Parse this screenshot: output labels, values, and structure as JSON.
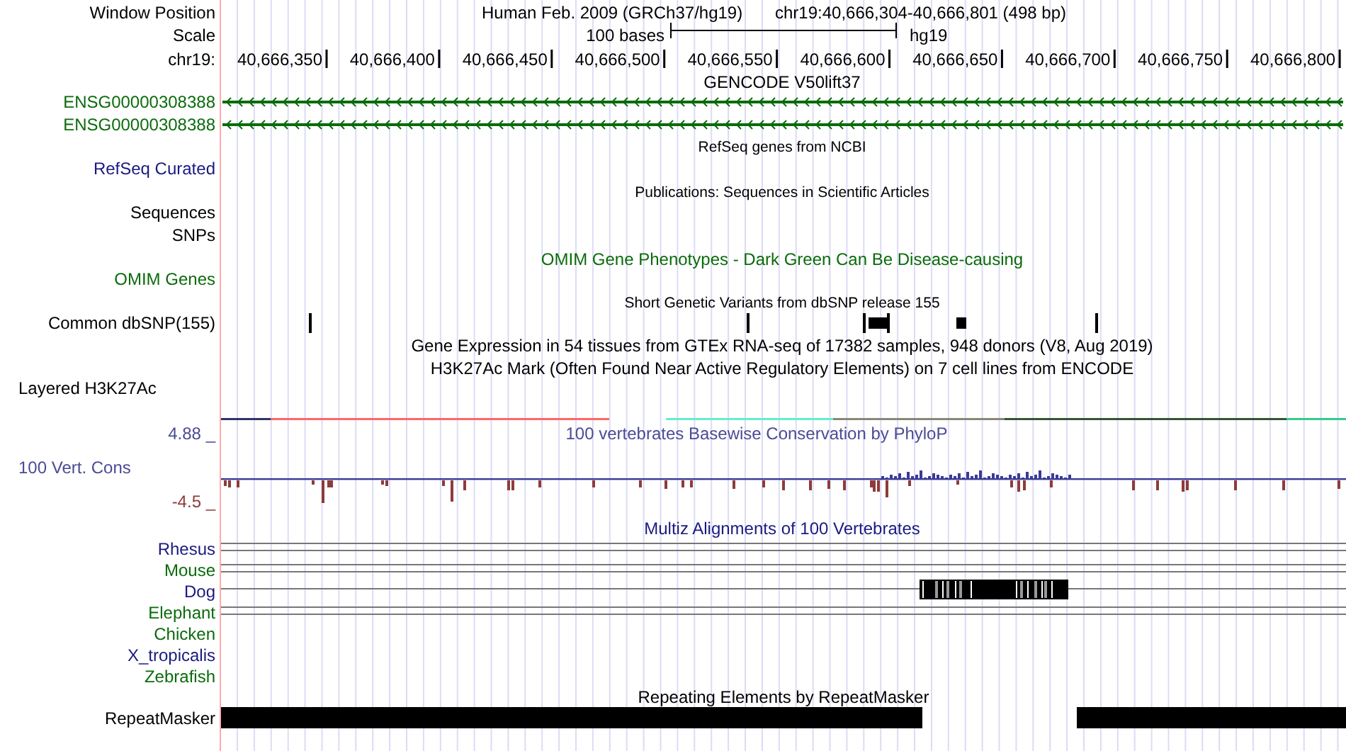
{
  "header": {
    "position_label": "Window Position",
    "assembly": "Human Feb. 2009 (GRCh37/hg19)",
    "position": "chr19:40,666,304-40,666,801 (498 bp)"
  },
  "scale": {
    "label": "Scale",
    "length": "100 bases",
    "db": "hg19"
  },
  "ruler": {
    "label": "chr19:",
    "ticks": [
      "40,666,350",
      "40,666,400",
      "40,666,450",
      "40,666,500",
      "40,666,550",
      "40,666,600",
      "40,666,650",
      "40,666,700",
      "40,666,750",
      "40,666,800"
    ]
  },
  "tracks": [
    {
      "kind": "title",
      "title": "GENCODE V50lift37",
      "color": "#000000"
    },
    {
      "kind": "gene",
      "label": "ENSG00000308388",
      "color": "#0b6b0b"
    },
    {
      "kind": "gene",
      "label": "ENSG00000308388",
      "color": "#0b6b0b"
    },
    {
      "kind": "note",
      "title": "RefSeq genes from NCBI"
    },
    {
      "kind": "label",
      "label": "RefSeq Curated",
      "color": "#1a1a80"
    },
    {
      "kind": "note",
      "title": "Publications: Sequences in Scientific Articles"
    },
    {
      "kind": "label",
      "label": "Sequences",
      "color": "#000000"
    },
    {
      "kind": "label",
      "label": "SNPs",
      "color": "#000000"
    },
    {
      "kind": "title",
      "title": "OMIM Gene Phenotypes - Dark Green Can Be Disease-causing",
      "color": "#0b6b0b"
    },
    {
      "kind": "label",
      "label": "OMIM Genes",
      "color": "#0b6b0b"
    },
    {
      "kind": "note",
      "title": "Short Genetic Variants from dbSNP release 155"
    },
    {
      "kind": "snps",
      "label": "Common dbSNP(155)",
      "color": "#000000"
    },
    {
      "kind": "title",
      "title": "Gene Expression in 54 tissues from GTEx RNA-seq of 17382 samples, 948 donors (V8, Aug 2019)",
      "color": "#000000"
    },
    {
      "kind": "title",
      "title": "H3K27Ac Mark (Often Found Near Active Regulatory Elements) on 7 cell lines from ENCODE",
      "color": "#000000"
    },
    {
      "kind": "layers",
      "label": "Layered H3K27Ac",
      "color": "#000000"
    },
    {
      "kind": "wiggle",
      "title": "100 vertebrates Basewise Conservation by PhyloP",
      "label": "100 Vert. Cons",
      "max": "4.88 _",
      "min": "-4.5 _",
      "color": "#4b4b95"
    },
    {
      "kind": "title",
      "title": "Multiz Alignments of 100 Vertebrates",
      "color": "#1a1a80"
    },
    {
      "kind": "species",
      "species": [
        {
          "name": "Rhesus",
          "kind": "double",
          "color": "#1a1a80"
        },
        {
          "name": "Mouse",
          "kind": "double",
          "color": "#0b6b0b"
        },
        {
          "name": "Dog",
          "kind": "aligned",
          "color": "#1a1a80"
        },
        {
          "name": "Elephant",
          "kind": "double",
          "color": "#0b6b0b"
        },
        {
          "name": "Chicken",
          "kind": "empty",
          "color": "#0b6b0b"
        },
        {
          "name": "X_tropicalis",
          "kind": "empty",
          "color": "#1a1a80"
        },
        {
          "name": "Zebrafish",
          "kind": "empty",
          "color": "#0b6b0b"
        }
      ]
    },
    {
      "kind": "repeat",
      "title": "Repeating Elements by RepeatMasker",
      "label": "RepeatMasker",
      "color": "#000000"
    }
  ]
}
